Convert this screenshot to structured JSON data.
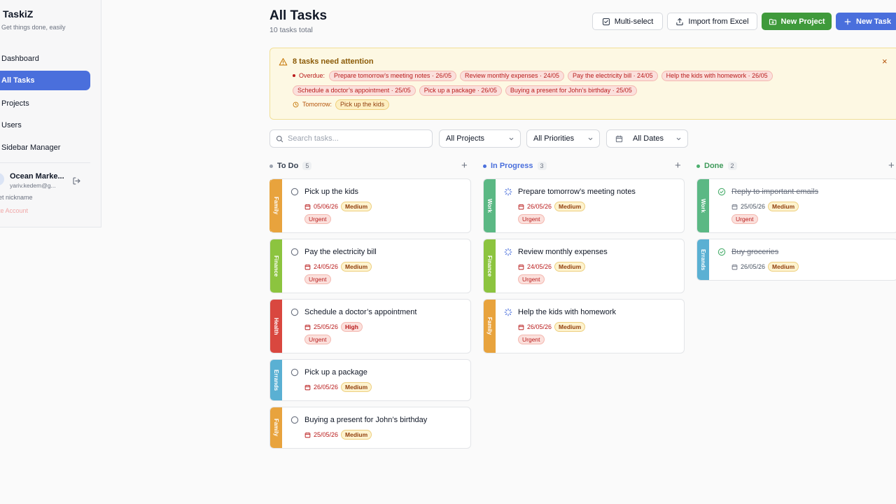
{
  "brand": {
    "name": "TaskiZ",
    "tagline": "Get things done, easily"
  },
  "nav": [
    {
      "label": "Dashboard",
      "active": false
    },
    {
      "label": "All Tasks",
      "active": true
    },
    {
      "label": "Projects",
      "active": false
    },
    {
      "label": "Users",
      "active": false
    },
    {
      "label": "Sidebar Manager",
      "active": false
    }
  ],
  "user": {
    "name": "Ocean Marke...",
    "email": "yariv.kedem@g...",
    "nickname_action": "et nickname",
    "delete_action": "te Account"
  },
  "header": {
    "title": "All Tasks",
    "subtitle": "10 tasks total",
    "buttons": {
      "multi_select": "Multi-select",
      "import": "Import from Excel",
      "new_project": "New Project",
      "new_task": "New Task"
    }
  },
  "alert": {
    "title": "8 tasks need attention",
    "overdue_label": "Overdue:",
    "overdue": [
      "Prepare tomorrow’s meeting notes · 26/05",
      "Review monthly expenses · 24/05",
      "Pay the electricity bill · 24/05",
      "Help the kids with homework · 26/05",
      "Schedule a doctor’s appointment · 25/05",
      "Pick up a package · 26/05",
      "Buying a present for John’s birthday · 25/05"
    ],
    "tomorrow_label": "Tomorrow:",
    "tomorrow": [
      "Pick up the kids"
    ],
    "close": "×"
  },
  "filters": {
    "search_placeholder": "Search tasks...",
    "projects": "All Projects",
    "priorities": "All Priorities",
    "dates": "All Dates"
  },
  "columns": [
    {
      "title": "To Do",
      "count": "5",
      "color": "#9ca3af",
      "title_color": "#374151",
      "cards": [
        {
          "category": "Family",
          "color": "#e8a33d",
          "title": "Pick up the kids",
          "date": "05/06/26",
          "priority": "Medium",
          "urgent": "Urgent"
        },
        {
          "category": "Finance",
          "color": "#8cc43f",
          "title": "Pay the electricity bill",
          "date": "24/05/26",
          "priority": "Medium",
          "urgent": "Urgent"
        },
        {
          "category": "Health",
          "color": "#d9473f",
          "title": "Schedule a doctor’s appointment",
          "date": "25/05/26",
          "priority": "High",
          "urgent": "Urgent"
        },
        {
          "category": "Errands",
          "color": "#5ab0d3",
          "title": "Pick up a package",
          "date": "26/05/26",
          "priority": "Medium"
        },
        {
          "category": "Family",
          "color": "#e8a33d",
          "title": "Buying a present for John’s birthday",
          "date": "25/05/26",
          "priority": "Medium"
        }
      ]
    },
    {
      "title": "In Progress",
      "count": "3",
      "color": "#4a6fdc",
      "title_color": "#4a6fdc",
      "cards": [
        {
          "category": "Work",
          "color": "#5bb884",
          "title": "Prepare tomorrow’s meeting notes",
          "date": "26/05/26",
          "priority": "Medium",
          "urgent": "Urgent"
        },
        {
          "category": "Finance",
          "color": "#8cc43f",
          "title": "Review monthly expenses",
          "date": "24/05/26",
          "priority": "Medium",
          "urgent": "Urgent"
        },
        {
          "category": "Family",
          "color": "#e8a33d",
          "title": "Help the kids with homework",
          "date": "26/05/26",
          "priority": "Medium",
          "urgent": "Urgent"
        }
      ]
    },
    {
      "title": "Done",
      "count": "2",
      "color": "#4caf6e",
      "title_color": "#3f9a5a",
      "cards": [
        {
          "category": "Work",
          "color": "#5bb884",
          "title": "Reply to important emails",
          "date": "25/05/26",
          "priority": "Medium",
          "urgent": "Urgent"
        },
        {
          "category": "Errands",
          "color": "#5ab0d3",
          "title": "Buy groceries",
          "date": "26/05/26",
          "priority": "Medium"
        }
      ]
    }
  ]
}
